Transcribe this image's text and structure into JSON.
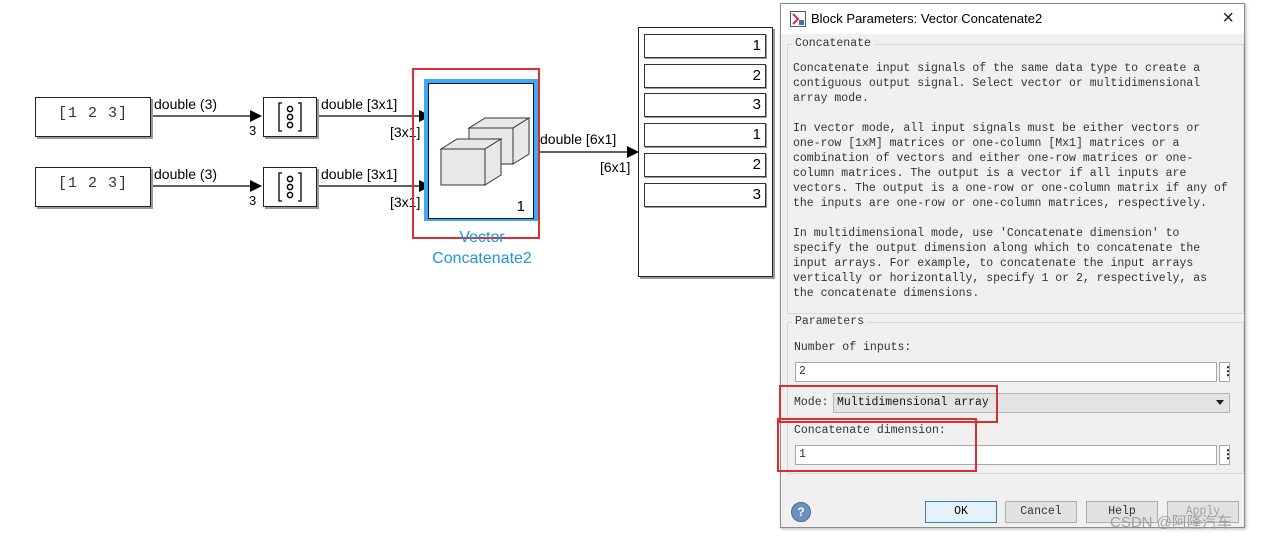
{
  "model": {
    "constants": [
      {
        "value": "[1 2 3]",
        "signal_label": "double (3)",
        "out_dim": "3"
      },
      {
        "value": "[1 2 3]",
        "signal_label": "double (3)",
        "out_dim": "3"
      }
    ],
    "reshapes": [
      {
        "signal_label": "double [3x1]",
        "port_dim": "[3x1]"
      },
      {
        "signal_label": "double [3x1]",
        "port_dim": "[3x1]"
      }
    ],
    "concat_block": {
      "name_line1": "Vector",
      "name_line2": "Concatenate2",
      "port_number": "1"
    },
    "output_signal": {
      "label": "double [6x1]",
      "dim": "[6x1]"
    },
    "display": {
      "values": [
        "1",
        "2",
        "3",
        "1",
        "2",
        "3"
      ]
    },
    "colors": {
      "selection_blue": "#3fa9f5",
      "annotation_red": "#d9302f",
      "block_name_blue": "#1e95e0"
    }
  },
  "dialog": {
    "title": "Block Parameters: Vector Concatenate2",
    "close_icon": "×",
    "description_group_label": "Concatenate",
    "description_paragraphs": [
      "Concatenate input signals of the same data type to create a contiguous output signal. Select vector or multidimensional array mode.",
      "In vector mode, all input signals must be either vectors or one-row [1xM] matrices or one-column [Mx1] matrices or a combination of vectors and either one-row matrices or one-column matrices. The output is a vector if all inputs are vectors. The output is a one-row or one-column matrix if any of the inputs are one-row or one-column matrices, respectively.",
      "In multidimensional mode, use 'Concatenate dimension' to specify the output dimension along which to concatenate the input arrays. For example, to concatenate the input arrays vertically or horizontally, specify 1 or 2, respectively, as the concatenate dimensions."
    ],
    "params_group_label": "Parameters",
    "num_inputs_label": "Number of inputs:",
    "num_inputs_value": "2",
    "mode_label": "Mode:",
    "mode_value": "Multidimensional array",
    "concat_dim_label": "Concatenate dimension:",
    "concat_dim_value": "1",
    "more_icon": "⋮",
    "buttons": {
      "ok": "OK",
      "cancel": "Cancel",
      "help": "Help",
      "apply": "Apply"
    },
    "help_icon": "?"
  },
  "watermark": "CSDN @阿隆汽车"
}
